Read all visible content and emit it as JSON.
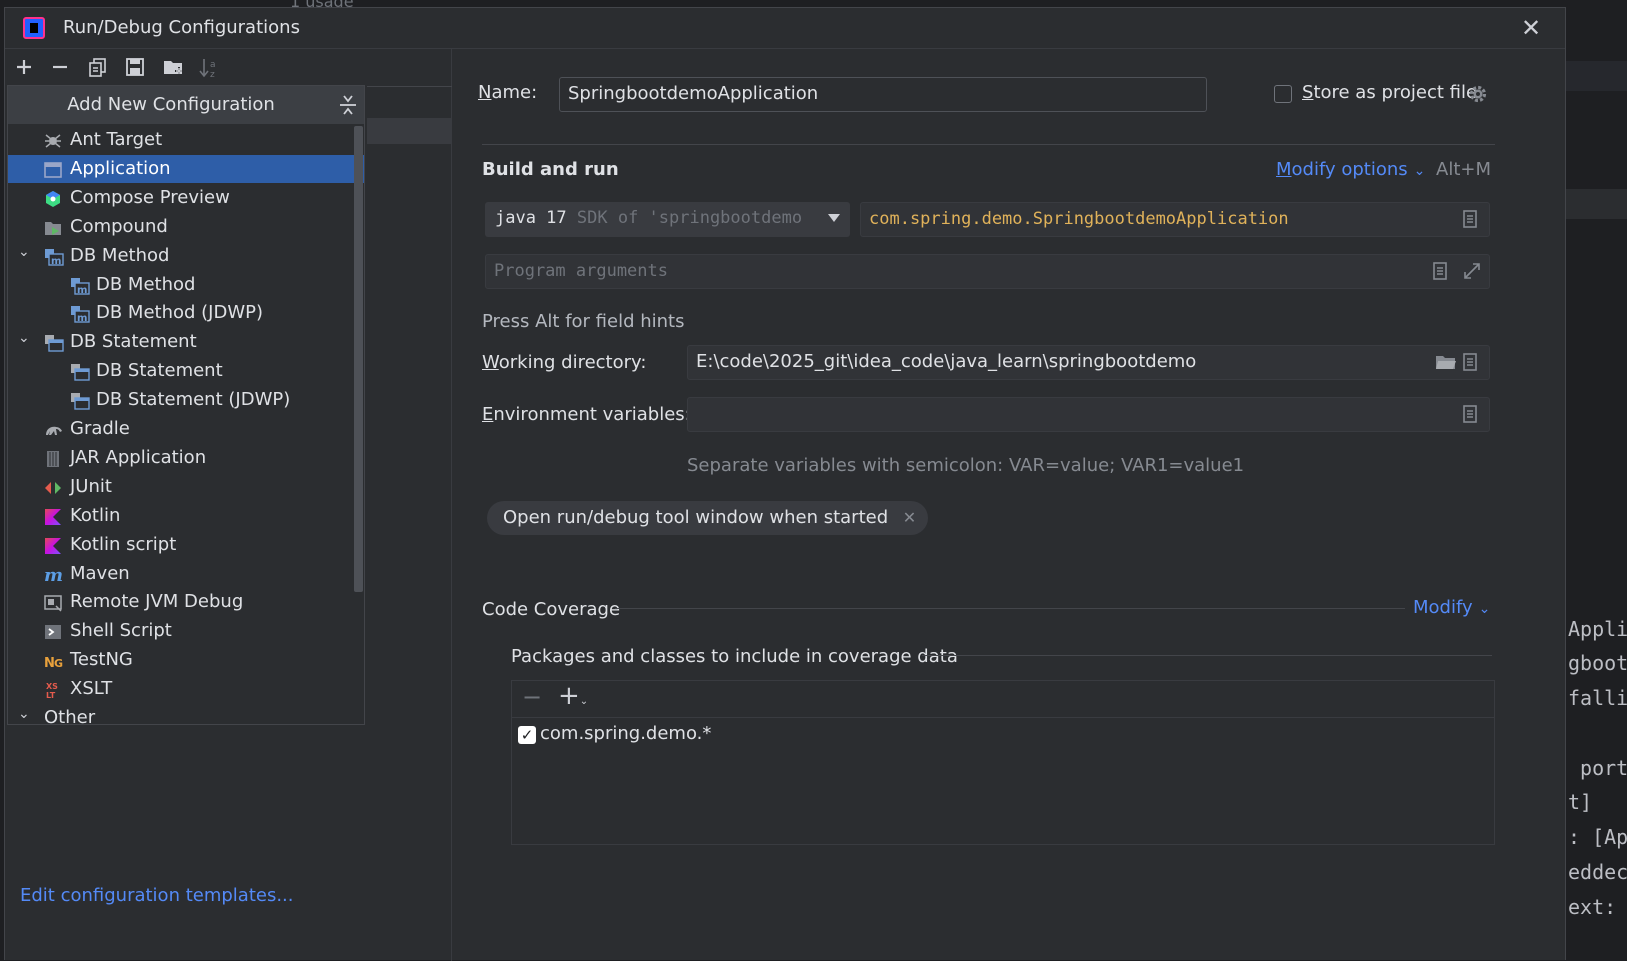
{
  "background": {
    "top_line": "1 usage",
    "code_lines": [
      "Appli",
      "gboot",
      "falli",
      "",
      " port",
      "t]",
      ": [Ap",
      "eddec",
      "ext:"
    ]
  },
  "dialog": {
    "title": "Run/Debug Configurations",
    "close_icon": "close-icon"
  },
  "left": {
    "toolbar": [
      "add-icon",
      "remove-icon",
      "copy-icon",
      "save-icon",
      "new-folder-icon",
      "sort-icon"
    ],
    "popup_title": "Add New Configuration",
    "items": [
      {
        "label": "Ant Target",
        "icon": "ant-icon",
        "indent": 0
      },
      {
        "label": "Application",
        "icon": "application-icon",
        "indent": 0,
        "selected": true
      },
      {
        "label": "Compose Preview",
        "icon": "compose-icon",
        "indent": 0
      },
      {
        "label": "Compound",
        "icon": "compound-icon",
        "indent": 0
      },
      {
        "label": "DB Method",
        "icon": "db-method-icon",
        "indent": 0,
        "expanded": true
      },
      {
        "label": "DB Method",
        "icon": "db-method-icon",
        "indent": 1
      },
      {
        "label": "DB Method (JDWP)",
        "icon": "db-method-icon",
        "indent": 1
      },
      {
        "label": "DB Statement",
        "icon": "db-statement-icon",
        "indent": 0,
        "expanded": true
      },
      {
        "label": "DB Statement",
        "icon": "db-statement-icon",
        "indent": 1
      },
      {
        "label": "DB Statement (JDWP)",
        "icon": "db-statement-icon",
        "indent": 1
      },
      {
        "label": "Gradle",
        "icon": "gradle-icon",
        "indent": 0
      },
      {
        "label": "JAR Application",
        "icon": "jar-icon",
        "indent": 0
      },
      {
        "label": "JUnit",
        "icon": "junit-icon",
        "indent": 0
      },
      {
        "label": "Kotlin",
        "icon": "kotlin-icon",
        "indent": 0
      },
      {
        "label": "Kotlin script",
        "icon": "kotlin-icon",
        "indent": 0
      },
      {
        "label": "Maven",
        "icon": "maven-icon",
        "indent": 0
      },
      {
        "label": "Remote JVM Debug",
        "icon": "remote-debug-icon",
        "indent": 0
      },
      {
        "label": "Shell Script",
        "icon": "shell-icon",
        "indent": 0
      },
      {
        "label": "TestNG",
        "icon": "testng-icon",
        "indent": 0
      },
      {
        "label": "XSLT",
        "icon": "xslt-icon",
        "indent": 0
      },
      {
        "label": "Other",
        "icon": "",
        "indent": 0,
        "expanded": true
      }
    ],
    "edit_templates": "Edit configuration templates..."
  },
  "form": {
    "name_label_u": "N",
    "name_label_rest": "ame:",
    "name_value": "SpringbootdemoApplication",
    "store_label_u": "S",
    "store_label_rest": "tore as project file",
    "build_run": "Build and run",
    "modify_u": "M",
    "modify_rest": "odify options",
    "modify_shortcut": "Alt+M",
    "jdk_main": "java 17",
    "jdk_hint": " SDK of 'springbootdemo",
    "main_class": "com.spring.demo.SpringbootdemoApplication",
    "program_args_placeholder": "Program arguments",
    "hint": "Press Alt for field hints",
    "wd_label_u": "W",
    "wd_label_rest": "orking directory:",
    "wd_value": "E:\\code\\2025_git\\idea_code\\java_learn\\springbootdemo",
    "env_label_u": "E",
    "env_label_rest": "nvironment variables:",
    "env_value": "",
    "env_help": "Separate variables with semicolon: VAR=value; VAR1=value1",
    "chip": "Open run/debug tool window when started",
    "code_coverage": "Code Coverage",
    "cc_modify": "Modify",
    "packages_label": "Packages and classes to include in coverage data",
    "package_entry": "com.spring.demo.*"
  },
  "colors": {
    "accent": "#548af7",
    "selection": "#2e5ea8",
    "class_name": "#e0b25a",
    "background": "#2b2d30"
  }
}
